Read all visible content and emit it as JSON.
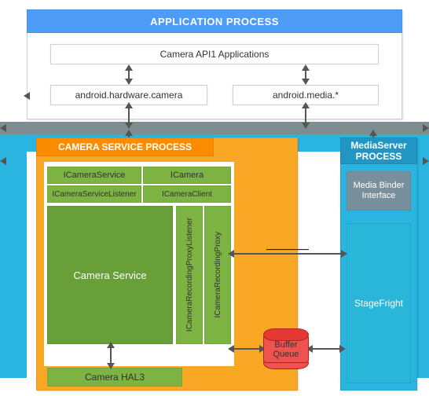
{
  "app_process": {
    "title": "APPLICATION PROCESS",
    "api_box": "Camera API1 Applications",
    "hw_camera": "android.hardware.camera",
    "media": "android.media.*"
  },
  "camera_service_process": {
    "title": "CAMERA SERVICE PROCESS",
    "icamera_service": "ICameraService",
    "icamera": "ICamera",
    "icamera_service_listener": "ICameraServiceListener",
    "icamera_client": "ICameraClient",
    "camera_service": "Camera Service",
    "proxy_listener": "ICameraRecordingProxyListener",
    "proxy": "ICameraRecordingProxy",
    "camera_hal3": "Camera HAL3"
  },
  "mediaserver_process": {
    "title": "MediaServer PROCESS",
    "binder": "Media Binder Interface",
    "stagefright": "StageFright"
  },
  "buffer_queue": "Buffer Queue",
  "colors": {
    "header_blue": "#4e9cf5",
    "cyan": "#2ab4e0",
    "orange_body": "#f9a825",
    "orange_header": "#fb8c00",
    "green": "#7cb342",
    "darkgreen": "#689f38",
    "gray_strip": "#7e8d90",
    "gray_box": "#78909c",
    "red": "#ef5350"
  }
}
